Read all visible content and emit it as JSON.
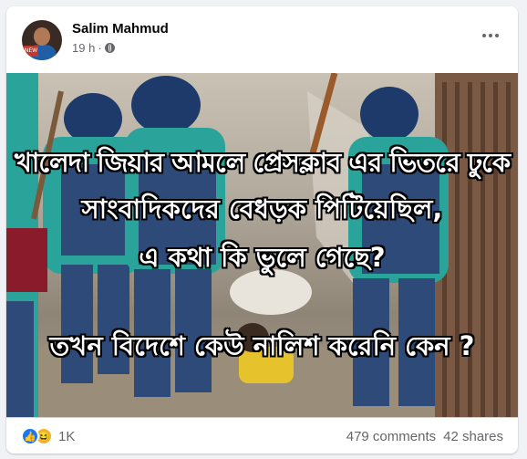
{
  "post": {
    "author": "Salim Mahmud",
    "time": "19 h",
    "separator": "·",
    "avatar_badge": "NEW",
    "image_text": {
      "line1": "খালেদা জিয়ার আমলে প্রেসক্লাব এর ভিতরে ঢুকে",
      "line2": "সাংবাদিকদের বেধড়ক পিটিয়েছিল,",
      "line3": "এ কথা কি ভুলে গেছে?",
      "line4": "তখন বিদেশে কেউ নালিশ করেনি কেন ?"
    }
  },
  "footer": {
    "reaction_count": "1K",
    "comments": "479 comments",
    "shares": "42 shares"
  },
  "icons": {
    "like": "like-icon",
    "haha": "haha-icon",
    "globe": "globe-icon",
    "more": "more-options-icon"
  },
  "colors": {
    "like_blue": "#1877f2",
    "haha_yellow": "#f7b125",
    "police_uniform": "#2e4a78",
    "helmet": "#1e3a6b",
    "turquoise_uniform": "#2aa39b"
  }
}
